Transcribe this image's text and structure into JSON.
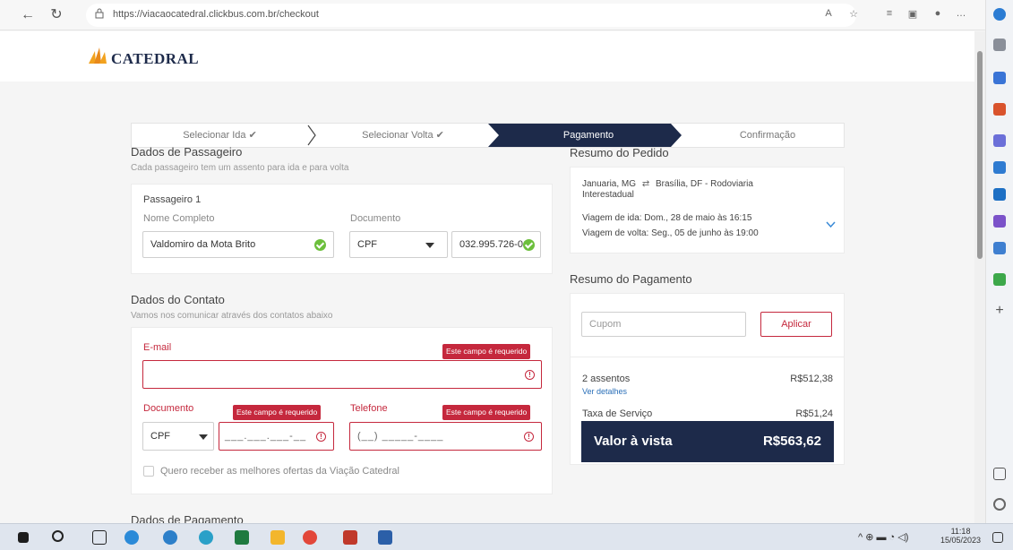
{
  "browser": {
    "url": "https://viacaocatedral.clickbus.com.br/checkout"
  },
  "site": {
    "brand": "CATEDRAL"
  },
  "steps": [
    {
      "label": "Selecionar Ida ✔"
    },
    {
      "label": "Selecionar Volta ✔"
    },
    {
      "label": "Pagamento"
    },
    {
      "label": "Confirmação"
    }
  ],
  "passenger_section": {
    "title": "Dados de Passageiro",
    "subtitle": "Cada passageiro tem um assento para ida e para volta",
    "passenger_label": "Passageiro 1",
    "name_label": "Nome Completo",
    "name_value": "Valdomiro da Mota Brito",
    "doc_label": "Documento",
    "doc_type": "CPF",
    "doc_value": "032.995.726-01"
  },
  "contact_section": {
    "title": "Dados do Contato",
    "subtitle": "Vamos nos comunicar através dos contatos abaixo",
    "email_label": "E-mail",
    "required_error": "Este campo é requerido",
    "doc_label": "Documento",
    "doc_type": "CPF",
    "doc_mask": "___.___.___-__",
    "phone_label": "Telefone",
    "phone_mask": "(__) _____-____",
    "offers_checkbox_label": "Quero receber as melhores ofertas da Viação Catedral"
  },
  "payment_section": {
    "title": "Dados de Pagamento"
  },
  "order_summary": {
    "title": "Resumo do Pedido",
    "origin": "Januaria, MG",
    "destination": "Brasília, DF - Rodoviaria Interestadual",
    "outbound": "Viagem de ida: Dom., 28 de maio às 16:15",
    "return": "Viagem de volta: Seg., 05 de junho às 19:00"
  },
  "payment_summary": {
    "title": "Resumo do Pagamento",
    "coupon_placeholder": "Cupom",
    "apply_label": "Aplicar",
    "seats_label": "2 assentos",
    "seats_value": "R$512,38",
    "details_link": "Ver detalhes",
    "fee_label": "Taxa de Serviço",
    "fee_value": "R$51,24",
    "total_label": "Valor à vista",
    "total_value": "R$563,62"
  },
  "taskbar": {
    "time": "11:18",
    "date": "15/05/2023"
  },
  "colors": {
    "brand_navy": "#1d2a4a",
    "error_red": "#c5283d",
    "success_green": "#6cbf3c"
  }
}
